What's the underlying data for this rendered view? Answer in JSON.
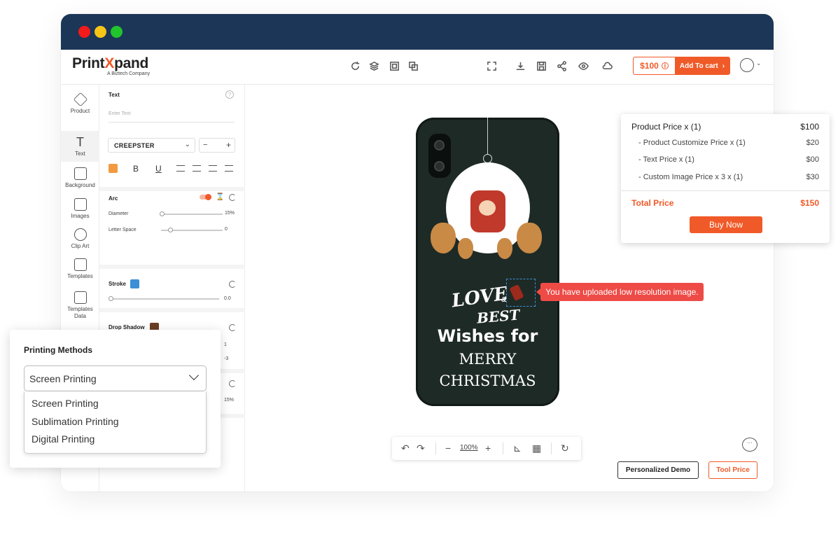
{
  "brand": {
    "name_prefix": "Print",
    "name_x": "X",
    "name_suffix": "pand",
    "tagline": "A Biztech Company"
  },
  "topbar": {
    "price": "$100",
    "price_info_icon": "info-icon",
    "add_to_cart": "Add To cart",
    "accent": "#f05a28"
  },
  "nav": [
    {
      "label": "Product",
      "icon": "cube-icon"
    },
    {
      "label": "Text",
      "icon": "text-icon"
    },
    {
      "label": "Background",
      "icon": "background-icon"
    },
    {
      "label": "Images",
      "icon": "image-icon"
    },
    {
      "label": "Clip Art",
      "icon": "clipart-icon"
    },
    {
      "label": "Templates",
      "icon": "templates-icon"
    },
    {
      "label": "Templates Data",
      "icon": "templates-data-icon"
    }
  ],
  "panel": {
    "text": {
      "title": "Text",
      "placeholder": "Enter Text",
      "font": "CREEPSTER",
      "minus": "−",
      "plus": "+",
      "bold": "B",
      "underline": "U"
    },
    "arc": {
      "title": "Arc",
      "diameter_label": "Diameter",
      "diameter_value": "15%",
      "letter_space_label": "Letter Space",
      "letter_space_value": "0"
    },
    "stroke": {
      "title": "Stroke",
      "value": "0.0",
      "color": "#3a8fd6"
    },
    "shadow": {
      "title": "Drop Shadow",
      "color": "#6a3e22",
      "value_a": "1",
      "value_b": "-3"
    },
    "extra": {
      "value": "15%"
    }
  },
  "design": {
    "line1": "LOVE",
    "amp": "&",
    "line2": "BEST",
    "line3": "Wishes for",
    "line4": "MERRY",
    "line5": "CHRISTMAS"
  },
  "tooltip": "You have uploaded low resolution image.",
  "price_card": {
    "rows": [
      {
        "label": "Product Price  x  (1)",
        "value": "$100"
      },
      {
        "label": "- Product Customize Price  x  (1)",
        "value": "$20"
      },
      {
        "label": "- Text Price x (1)",
        "value": "$00"
      },
      {
        "label": "- Custom Image Price x 3 x  (1)",
        "value": "$30"
      }
    ],
    "total_label": "Total Price",
    "total_value": "$150",
    "buy_now": "Buy Now"
  },
  "zoom": {
    "value": "100%",
    "minus": "−",
    "plus": "+"
  },
  "buttons": {
    "demo": "Personalized Demo",
    "tool_price": "Tool Price"
  },
  "printing": {
    "title": "Printing Methods",
    "selected": "Screen Printing",
    "options": [
      "Screen Printing",
      "Sublimation Printing",
      "Digital Printing"
    ]
  }
}
